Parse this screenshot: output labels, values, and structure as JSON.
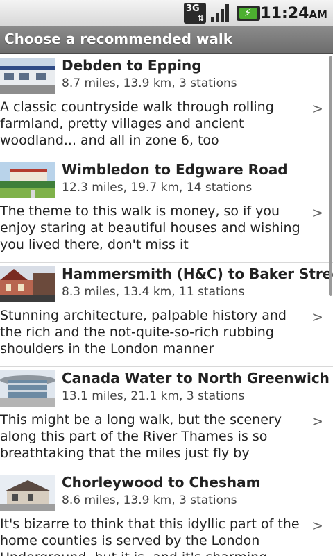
{
  "status_bar": {
    "network": "3G",
    "time": "11:24",
    "ampm": "AM"
  },
  "header": {
    "title": "Choose a recommended walk"
  },
  "walks": [
    {
      "title": "Debden to Epping",
      "meta": "8.7 miles, 13.9 km, 3 stations",
      "description": "A classic countryside walk through rolling farmland, pretty villages and ancient woodland... and all in zone 6, too"
    },
    {
      "title": "Wimbledon to Edgware Road",
      "meta": "12.3 miles, 19.7 km, 14 stations",
      "description": "The theme to this walk is money, so if you enjoy staring at beautiful houses and wishing you lived there, don't miss it"
    },
    {
      "title": "Hammersmith (H&C) to Baker Street",
      "meta": "8.3 miles, 13.4 km, 11 stations",
      "description": "Stunning architecture, palpable history and the rich and the not-quite-so-rich rubbing shoulders in the London manner"
    },
    {
      "title": "Canada Water to North Greenwich",
      "meta": "13.1 miles, 21.1 km, 3 stations",
      "description": "This might be a long walk, but the scenery along this part of the River Thames is so breathtaking that the miles just fly by"
    },
    {
      "title": "Chorleywood to Chesham",
      "meta": "8.6 miles, 13.9 km, 3 stations",
      "description": "It's bizarre to think that this idyllic part of the home counties is served by the London Underground, but it is, and it's charming"
    }
  ],
  "chevron": ">"
}
